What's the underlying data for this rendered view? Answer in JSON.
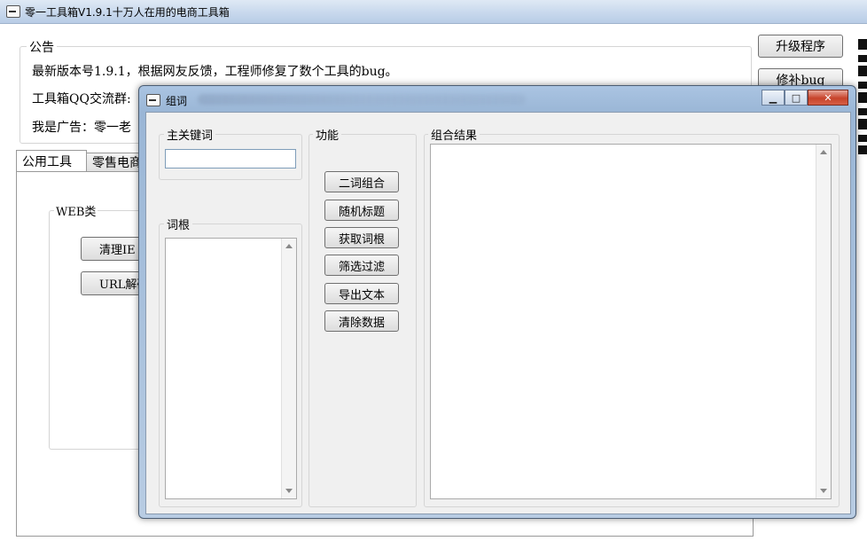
{
  "main_window": {
    "title": "零一工具箱V1.9.1十万人在用的电商工具箱",
    "notice_legend": "公告",
    "notice_lines": [
      "最新版本号1.9.1，根据网友反馈，工程师修复了数个工具的bug。",
      "工具箱QQ交流群:",
      "我是广告：零一老"
    ],
    "side_buttons": [
      "升级程序",
      "修补bug"
    ],
    "tabs": [
      "公用工具",
      "零售电商"
    ],
    "web_group_legend": "WEB类",
    "web_buttons": [
      "清理IE",
      "URL解码"
    ]
  },
  "dialog": {
    "title": "组词",
    "controls": [
      "minimize",
      "maximize",
      "close"
    ],
    "main_keyword": {
      "legend": "主关键词",
      "value": ""
    },
    "root_words": {
      "legend": "词根",
      "items": []
    },
    "functions": {
      "legend": "功能",
      "buttons": [
        "二词组合",
        "随机标题",
        "获取词根",
        "筛选过滤",
        "导出文本",
        "清除数据"
      ]
    },
    "result": {
      "legend": "组合结果",
      "value": ""
    }
  },
  "icons": {
    "app": "app-icon",
    "minimize": "minimize-icon",
    "maximize": "maximize-icon",
    "close": "close-icon"
  }
}
